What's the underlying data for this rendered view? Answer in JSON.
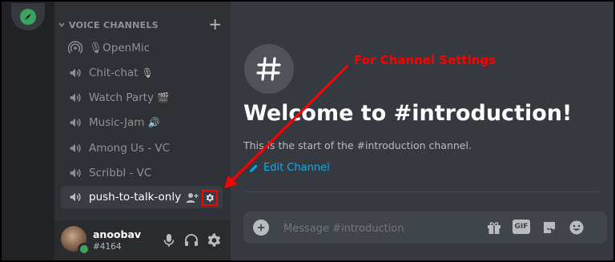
{
  "sidebar": {
    "category": "VOICE CHANNELS",
    "channels": [
      {
        "label": "🎙OpenMic",
        "emoji": ""
      },
      {
        "label": "Chit-chat",
        "emoji": "🎙"
      },
      {
        "label": "Watch Party",
        "emoji": "🎬"
      },
      {
        "label": "Music-Jam",
        "emoji": "🔊"
      },
      {
        "label": "Among Us - VC",
        "emoji": ""
      },
      {
        "label": "Scribbl - VC",
        "emoji": ""
      },
      {
        "label": "push-to-talk-only",
        "emoji": ""
      }
    ]
  },
  "user": {
    "name": "anoobav",
    "tag": "#4164"
  },
  "main": {
    "welcome": "Welcome to #introduction!",
    "subtitle": "This is the start of the #introduction channel.",
    "edit_channel": "Edit Channel",
    "message_placeholder": "Message #introduction",
    "gif_label": "GIF"
  },
  "annotation": {
    "text": "For Channel Settings"
  },
  "colors": {
    "accent": "#00b0f4",
    "annotation": "#ff0000",
    "online": "#3ba55d"
  }
}
